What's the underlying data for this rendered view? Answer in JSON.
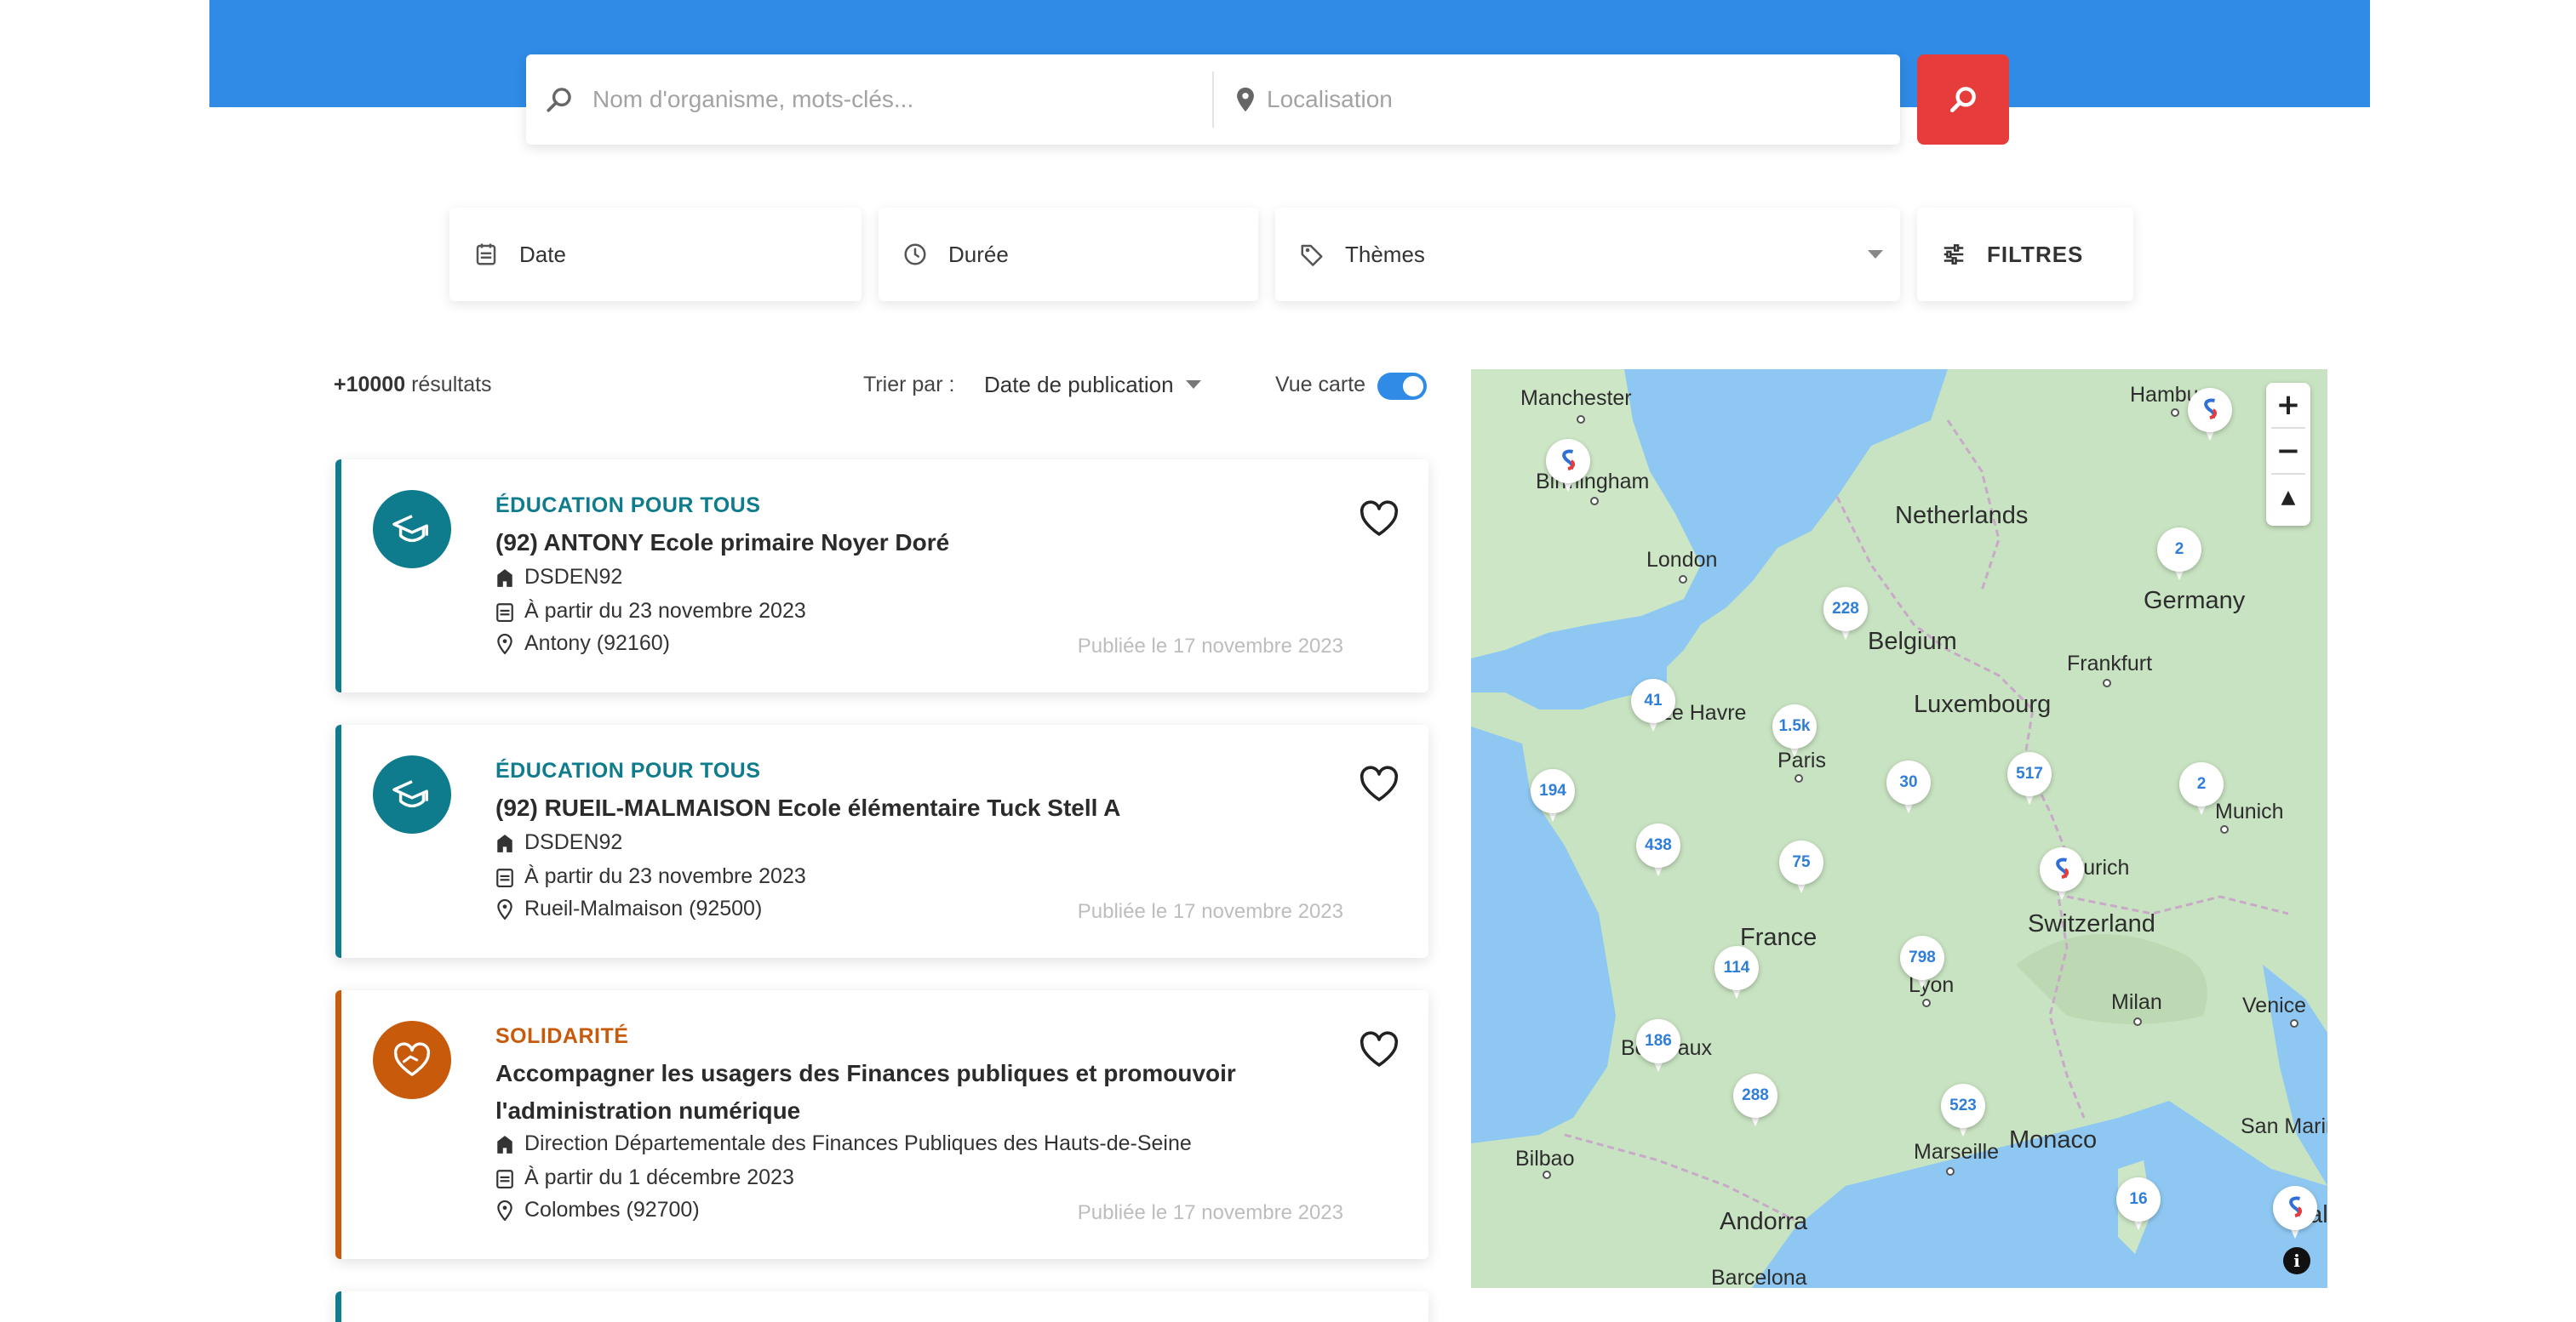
{
  "search": {
    "keywords_placeholder": "Nom d'organisme, mots-clés...",
    "location_placeholder": "Localisation"
  },
  "filters": {
    "date_label": "Date",
    "duration_label": "Durée",
    "themes_label": "Thèmes",
    "filters_label": "FILTRES"
  },
  "results": {
    "count": "+10000",
    "count_suffix": "résultats",
    "sort_label": "Trier par :",
    "sort_value": "Date de publication",
    "map_view_label": "Vue carte",
    "map_view_enabled": true
  },
  "cards": [
    {
      "theme": "ÉDUCATION POUR TOUS",
      "theme_color": "#0e7c8c",
      "title": "(92) ANTONY Ecole primaire Noyer Doré",
      "organization": "DSDEN92",
      "start": "À partir du 23 novembre 2023",
      "location": "Antony (92160)",
      "published": "Publiée le 17 novembre 2023",
      "icon": "graduation-cap-icon"
    },
    {
      "theme": "ÉDUCATION POUR TOUS",
      "theme_color": "#0e7c8c",
      "title": "(92) RUEIL-MALMAISON Ecole élémentaire Tuck Stell A",
      "organization": "DSDEN92",
      "start": "À partir du 23 novembre 2023",
      "location": "Rueil-Malmaison (92500)",
      "published": "Publiée le 17 novembre 2023",
      "icon": "graduation-cap-icon"
    },
    {
      "theme": "SOLIDARITÉ",
      "theme_color": "#c85a0c",
      "title": "Accompagner les usagers des Finances publiques et promouvoir l'administration numérique",
      "organization": "Direction Départementale des Finances Publiques des Hauts-de-Seine",
      "start": "À partir du 1 décembre 2023",
      "location": "Colombes (92700)",
      "published": "Publiée le 17 novembre 2023",
      "icon": "heart-hands-icon"
    }
  ],
  "map": {
    "cities": [
      {
        "name": "Manchester",
        "big": false
      },
      {
        "name": "Birmingham",
        "big": false
      },
      {
        "name": "London",
        "big": false
      },
      {
        "name": "Hamburg",
        "big": false
      },
      {
        "name": "Netherlands",
        "big": true
      },
      {
        "name": "Germany",
        "big": true
      },
      {
        "name": "Belgium",
        "big": true
      },
      {
        "name": "Frankfurt",
        "big": false
      },
      {
        "name": "Luxembourg",
        "big": true
      },
      {
        "name": "Le Havre",
        "big": false
      },
      {
        "name": "Paris",
        "big": false
      },
      {
        "name": "Munich",
        "big": false
      },
      {
        "name": "Zurich",
        "big": false
      },
      {
        "name": "Switzerland",
        "big": true
      },
      {
        "name": "France",
        "big": true
      },
      {
        "name": "Lyon",
        "big": false
      },
      {
        "name": "Milan",
        "big": false
      },
      {
        "name": "Venice",
        "big": false
      },
      {
        "name": "Bordeaux",
        "big": false
      },
      {
        "name": "Monaco",
        "big": true
      },
      {
        "name": "Marseille",
        "big": false
      },
      {
        "name": "San Marino",
        "big": false
      },
      {
        "name": "Bilbao",
        "big": false
      },
      {
        "name": "Andorra",
        "big": true
      },
      {
        "name": "Barcelona",
        "big": false
      },
      {
        "name": "Italy",
        "big": true
      }
    ],
    "clusters": [
      "228",
      "41",
      "1.5k",
      "194",
      "438",
      "75",
      "30",
      "517",
      "2",
      "2",
      "798",
      "114",
      "186",
      "288",
      "523",
      "16"
    ],
    "zoom_in": "+",
    "zoom_out": "−",
    "compass": "▲",
    "info": "i"
  }
}
